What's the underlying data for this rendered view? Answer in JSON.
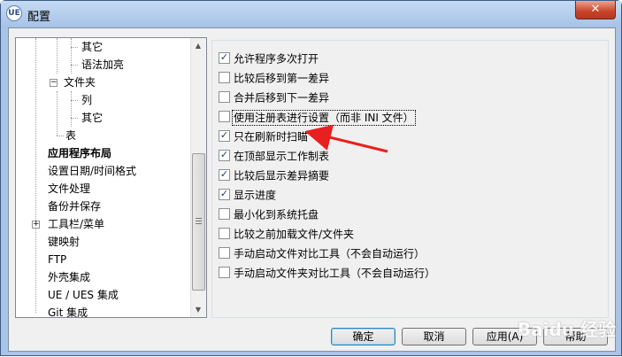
{
  "window": {
    "title": "配置",
    "icon_text": "UE",
    "close_symbol": "✕"
  },
  "tree": {
    "items": [
      {
        "label": "其它"
      },
      {
        "label": "语法加亮"
      },
      {
        "label": "文件夹"
      },
      {
        "label": "列"
      },
      {
        "label": "其它"
      },
      {
        "label": "表"
      },
      {
        "label": "应用程序布局"
      },
      {
        "label": "设置日期/时间格式"
      },
      {
        "label": "文件处理"
      },
      {
        "label": "备份并保存"
      },
      {
        "label": "工具栏/菜单"
      },
      {
        "label": "键映射"
      },
      {
        "label": "FTP"
      },
      {
        "label": "外壳集成"
      },
      {
        "label": "UE / UES 集成"
      },
      {
        "label": "Git 集成"
      }
    ]
  },
  "options": [
    {
      "label": "允许程序多次打开",
      "checked": true
    },
    {
      "label": "比较后移到第一差异",
      "checked": false
    },
    {
      "label": "合并后移到下一差异",
      "checked": false
    },
    {
      "label": "使用注册表进行设置（而非 INI 文件）",
      "checked": false
    },
    {
      "label": "只在刷新时扫瞄",
      "checked": true
    },
    {
      "label": "在顶部显示工作制表",
      "checked": true
    },
    {
      "label": "比较后显示差异摘要",
      "checked": true
    },
    {
      "label": "显示进度",
      "checked": true
    },
    {
      "label": "最小化到系统托盘",
      "checked": false
    },
    {
      "label": "比较之前加载文件/文件夹",
      "checked": false
    },
    {
      "label": "手动启动文件对比工具（不会自动运行）",
      "checked": false
    },
    {
      "label": "手动启动文件夹对比工具（不会自动运行）",
      "checked": false
    }
  ],
  "buttons": {
    "ok": "确定",
    "cancel": "取消",
    "apply": "应用(A)",
    "help": "帮助"
  },
  "watermark": "Baidu 经验",
  "colors": {
    "arrow": "#e8201f",
    "checkmark": "#1a3a7a"
  }
}
